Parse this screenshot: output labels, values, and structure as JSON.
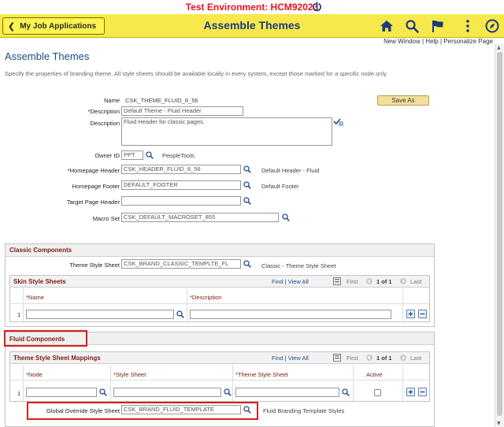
{
  "env_banner": {
    "text": "Test Environment: HCM92023"
  },
  "header": {
    "back_label": "My Job Applications",
    "title": "Assemble Themes",
    "icons": [
      "home-icon",
      "search-icon",
      "flag-icon",
      "more-icon",
      "compass-icon"
    ]
  },
  "links": {
    "new_window": "New Window",
    "help": "Help",
    "personalize": "Personalize Page",
    "sep": " | "
  },
  "page": {
    "title": "Assemble Themes",
    "instructions": "Specify the properties of branding theme. All style sheets should be available locally in every system, except those marked for a specific node only"
  },
  "fields": {
    "name_label": "Name",
    "name_value": "CSK_THEME_FLUID_8_56",
    "description_label": "*Description",
    "description_value": "Default Theme - Fluid Header",
    "long_desc_label": "Description",
    "long_desc_value": "Fluid Header for classic pages.",
    "owner_label": "Owner ID",
    "owner_value": "PPT",
    "owner_desc": "PeopleTools",
    "homepage_header_label": "*Homepage Header",
    "homepage_header_value": "CSK_HEADER_FLUID_8_56",
    "homepage_header_desc": "Default Header - Fluid",
    "homepage_footer_label": "Homepage Footer",
    "homepage_footer_value": "DEFAULT_FOOTER",
    "homepage_footer_desc": "Default Footer",
    "target_header_label": "Target Page Header",
    "target_header_value": "",
    "macro_label": "Macro Set",
    "macro_value": "CSK_DEFAULT_MACROSET_855"
  },
  "buttons": {
    "save_as": "Save As"
  },
  "classic": {
    "title": "Classic Components",
    "theme_label": "Theme Style Sheet",
    "theme_value": "CSK_BRAND_CLASSIC_TEMPLTE_FL",
    "theme_desc": "Classic - Theme Style Sheet",
    "skin_grid": {
      "title": "Skin Style Sheets",
      "find": "Find",
      "view_all": "View All",
      "first": "First",
      "count": "1 of 1",
      "last": "Last",
      "columns": [
        "*Name",
        "*Description"
      ],
      "row_num": "1"
    }
  },
  "fluid": {
    "title": "Fluid Components",
    "mapping_grid": {
      "title": "Theme Style Sheet Mappings",
      "find": "Find",
      "view_all": "View All",
      "first": "First",
      "count": "1 of 1",
      "last": "Last",
      "columns": [
        "*Node",
        "*Style Sheet",
        "*Theme Style Sheet",
        "Active"
      ],
      "row_num": "1"
    },
    "override_label": "Global Override Style Sheet",
    "override_value": "CSK_BRAND_FLUID_TEMPLATE",
    "override_desc": "Fluid Branding Template Styles"
  },
  "colors": {
    "header_bg": "#f7e94b",
    "banner_text": "#e8111c",
    "highlight": "#d81e1e",
    "title_blue": "#1d3a80"
  }
}
